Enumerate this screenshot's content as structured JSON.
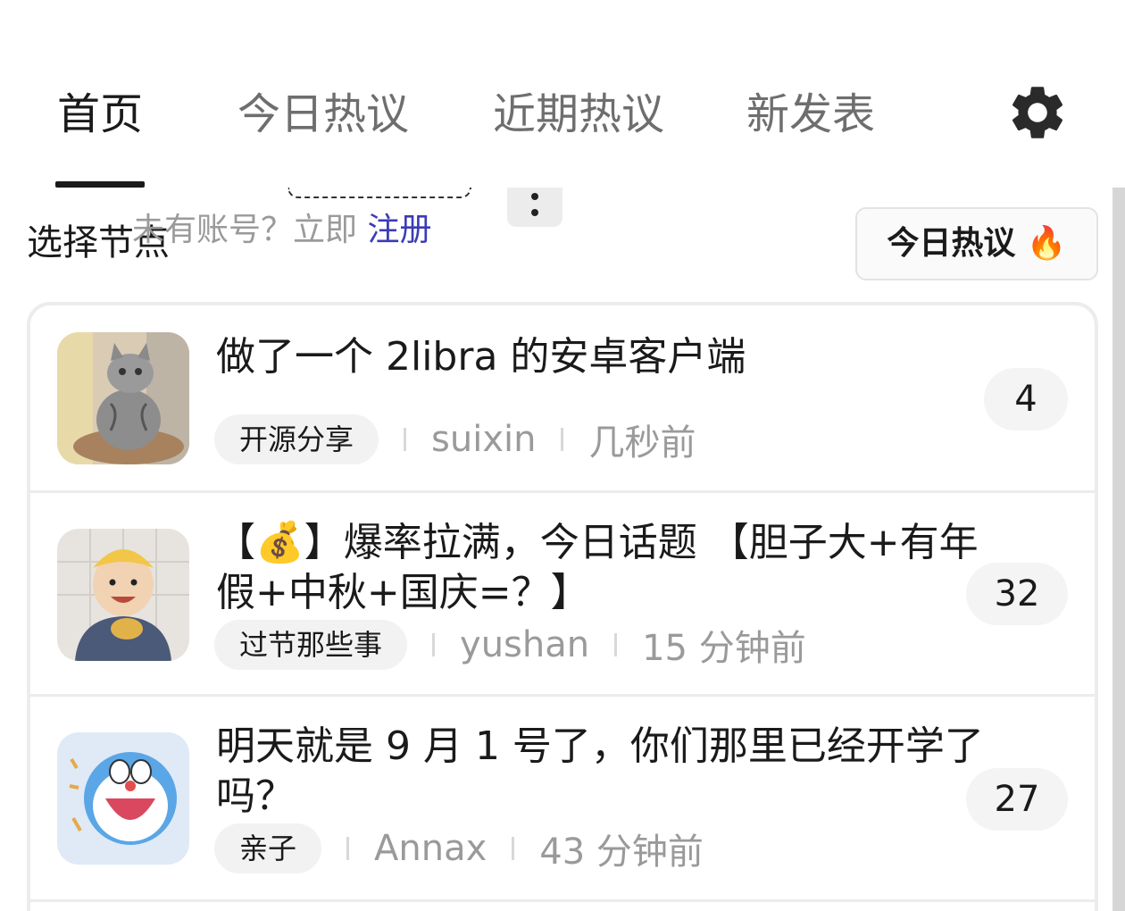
{
  "tabs": [
    {
      "label": "首页",
      "active": true
    },
    {
      "label": "今日热议",
      "active": false
    },
    {
      "label": "近期热议",
      "active": false
    },
    {
      "label": "新发表",
      "active": false
    }
  ],
  "settings_icon": "gear-icon",
  "node_section": {
    "title": "选择节点"
  },
  "signup_tip": {
    "text": "未有账号？立即 ",
    "link": "注册"
  },
  "hot_button": {
    "label": "今日热议 ",
    "icon": "🔥"
  },
  "colors": {
    "link": "#3b3bb8",
    "flame": "#f37a16",
    "muted": "#9a9a9a"
  },
  "topics": [
    {
      "title": "做了一个 2libra 的安卓客户端",
      "node": "开源分享",
      "author": "suixin",
      "time": "几秒前",
      "replies": "4",
      "avatar": "cat-avatar"
    },
    {
      "title": "【💰】爆率拉满，今日话题 【胆子大+有年假+中秋+国庆=？】",
      "node": "过节那些事",
      "author": "yushan",
      "time": "15 分钟前",
      "replies": "32",
      "avatar": "child-avatar"
    },
    {
      "title": "明天就是 9 月 1 号了，你们那里已经开学了吗？",
      "node": "亲子",
      "author": "Annax",
      "time": "43 分钟前",
      "replies": "27",
      "avatar": "doraemon-avatar"
    }
  ]
}
